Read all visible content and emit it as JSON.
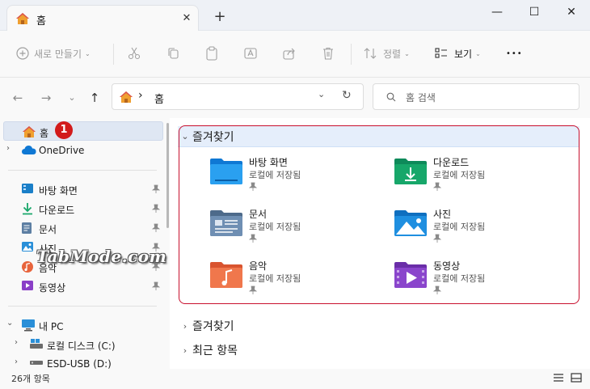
{
  "window": {
    "tab_title": "홈",
    "tab_close": "✕",
    "new_tab": "+",
    "minimize": "—",
    "maximize": "☐",
    "close": "✕"
  },
  "toolbar": {
    "new_label": "새로 만들기",
    "sort_label": "정렬",
    "view_label": "보기",
    "more_label": "•••"
  },
  "address": {
    "path_separator": "›",
    "path_current": "홈",
    "search_placeholder": "홈 검색"
  },
  "sidebar": {
    "home": "홈",
    "onedrive": "OneDrive",
    "pinned": [
      {
        "label": "바탕 화면",
        "icon": "desktop-icon"
      },
      {
        "label": "다운로드",
        "icon": "download-icon"
      },
      {
        "label": "문서",
        "icon": "document-icon"
      },
      {
        "label": "사진",
        "icon": "pictures-icon"
      },
      {
        "label": "음악",
        "icon": "music-icon"
      },
      {
        "label": "동영상",
        "icon": "videos-icon"
      }
    ],
    "this_pc": "내 PC",
    "drives": [
      {
        "label": "로컬 디스크 (C:)"
      },
      {
        "label": "ESD-USB (D:)"
      }
    ]
  },
  "badge": "1",
  "content": {
    "favorites_header": "즐겨찾기",
    "tiles": [
      {
        "name": "바탕 화면",
        "sub": "로컬에 저장됨"
      },
      {
        "name": "다운로드",
        "sub": "로컬에 저장됨"
      },
      {
        "name": "문서",
        "sub": "로컬에 저장됨"
      },
      {
        "name": "사진",
        "sub": "로컬에 저장됨"
      },
      {
        "name": "음악",
        "sub": "로컬에 저장됨"
      },
      {
        "name": "동영상",
        "sub": "로컬에 저장됨"
      }
    ],
    "favorites_header_2": "즐겨찾기",
    "recent_header": "최근 항목"
  },
  "watermark": "TabMode.com",
  "status": {
    "item_count": "26개 항목"
  },
  "colors": {
    "accent": "#0067c0",
    "highlight_frame": "#c8102e",
    "badge": "#d21b1b"
  }
}
